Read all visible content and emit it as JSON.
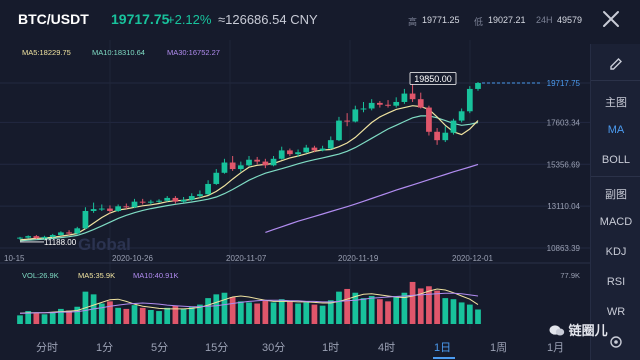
{
  "header": {
    "pair": "BTC/USDT",
    "price": "19717.75",
    "change": "+2.12%",
    "cny": "≈126686.54 CNY",
    "high_label": "高",
    "high_value": "19771.25",
    "low_label": "低",
    "low_value": "19027.21",
    "vol_label": "24H",
    "vol_value": "49579"
  },
  "indicators": {
    "ma5": "MA5:18229.75",
    "ma10": "MA10:18310.64",
    "ma30": "MA30:16752.27"
  },
  "toolbar": {
    "main_label": "主图",
    "ma": "MA",
    "boll": "BOLL",
    "sub_label": "副图",
    "macd": "MACD",
    "kdj": "KDJ",
    "rsi": "RSI",
    "wr": "WR"
  },
  "volume": {
    "vol": "VOL:26.9K",
    "ma5": "MA5:35.9K",
    "ma10": "MA10:40.91K",
    "max": "77.9K"
  },
  "tabs": [
    "分时",
    "1分",
    "5分",
    "15分",
    "30分",
    "1时",
    "4时",
    "1日",
    "1周",
    "1月"
  ],
  "active_tab": "1日",
  "watermark": "链圈儿",
  "watermark_bg": "Global",
  "colors": {
    "up": "#18c29c",
    "down": "#e0566b",
    "ma5": "#f0e3a0",
    "ma10": "#7fdcc4",
    "ma30": "#b18cf0",
    "accent": "#4b9bf0"
  },
  "chart_data": {
    "type": "candlestick",
    "y_ticks": [
      "19717.75",
      "17603.34",
      "15356.69",
      "13110.04",
      "10863.39"
    ],
    "x_ticks": [
      "10-15",
      "2020-10-26",
      "2020-11-07",
      "2020-11-19",
      "2020-12-01"
    ],
    "high_marker": "19850.00",
    "low_marker": "11188.00",
    "last_price": "19717.75",
    "ylim": [
      10863.39,
      19717.75
    ],
    "candles": [
      [
        11380,
        11420,
        11300,
        11460
      ],
      [
        11420,
        11500,
        11380,
        11540
      ],
      [
        11500,
        11390,
        11350,
        11560
      ],
      [
        11390,
        11460,
        11340,
        11520
      ],
      [
        11460,
        11560,
        11420,
        11620
      ],
      [
        11560,
        11700,
        11520,
        11760
      ],
      [
        11700,
        11640,
        11560,
        11820
      ],
      [
        11640,
        11920,
        11600,
        12000
      ],
      [
        11920,
        12850,
        11880,
        13050
      ],
      [
        12850,
        12950,
        12750,
        13300
      ],
      [
        12950,
        12980,
        12850,
        13200
      ],
      [
        12980,
        12850,
        12700,
        13150
      ],
      [
        12850,
        13100,
        12800,
        13200
      ],
      [
        13100,
        13050,
        12950,
        13250
      ],
      [
        13050,
        13350,
        13000,
        13500
      ],
      [
        13350,
        13300,
        13200,
        13500
      ],
      [
        13300,
        13350,
        13200,
        13450
      ],
      [
        13350,
        13400,
        13280,
        13480
      ],
      [
        13400,
        13550,
        13350,
        13650
      ],
      [
        13550,
        13350,
        13250,
        13650
      ],
      [
        13350,
        13450,
        13300,
        13600
      ],
      [
        13450,
        13650,
        13400,
        13800
      ],
      [
        13650,
        13750,
        13550,
        13950
      ],
      [
        13750,
        14300,
        13700,
        14500
      ],
      [
        14300,
        14900,
        14250,
        15100
      ],
      [
        14900,
        15450,
        14850,
        15650
      ],
      [
        15450,
        15100,
        15000,
        15800
      ],
      [
        15100,
        15300,
        14950,
        15500
      ],
      [
        15300,
        15600,
        15250,
        15800
      ],
      [
        15600,
        15500,
        15350,
        15750
      ],
      [
        15500,
        15300,
        15150,
        15650
      ],
      [
        15300,
        15650,
        15250,
        15800
      ],
      [
        15650,
        16100,
        15600,
        16300
      ],
      [
        16100,
        15900,
        15800,
        16200
      ],
      [
        15900,
        16000,
        15750,
        16150
      ],
      [
        16000,
        16250,
        15950,
        16400
      ],
      [
        16250,
        16100,
        16000,
        16350
      ],
      [
        16100,
        16200,
        16050,
        16350
      ],
      [
        16200,
        16650,
        16150,
        16850
      ],
      [
        16650,
        17700,
        16600,
        17900
      ],
      [
        17700,
        17650,
        17400,
        18100
      ],
      [
        17650,
        18300,
        17600,
        18500
      ],
      [
        18300,
        18350,
        18150,
        18700
      ],
      [
        18350,
        18650,
        18250,
        18850
      ],
      [
        18650,
        18550,
        18400,
        18750
      ],
      [
        18550,
        18500,
        18400,
        18800
      ],
      [
        18500,
        18700,
        18400,
        18950
      ],
      [
        18700,
        19150,
        18600,
        19400
      ],
      [
        19150,
        18850,
        18700,
        19850
      ],
      [
        18850,
        18400,
        18350,
        19200
      ],
      [
        18400,
        17100,
        16900,
        18500
      ],
      [
        17100,
        16650,
        16400,
        17300
      ],
      [
        16650,
        17050,
        16550,
        17400
      ],
      [
        17050,
        17700,
        16950,
        17800
      ],
      [
        17700,
        18200,
        17600,
        18350
      ],
      [
        18200,
        19400,
        18100,
        19550
      ],
      [
        19400,
        19717.75,
        19300,
        19771.25
      ]
    ],
    "ma5": [
      11300,
      11340,
      11380,
      11400,
      11440,
      11500,
      11560,
      11640,
      11900,
      12200,
      12500,
      12740,
      12900,
      12960,
      13050,
      13130,
      13180,
      13250,
      13350,
      13400,
      13420,
      13470,
      13560,
      13680,
      13900,
      14200,
      14560,
      14900,
      15200,
      15300,
      15350,
      15400,
      15550,
      15700,
      15800,
      15920,
      16050,
      16120,
      16150,
      16300,
      16500,
      16800,
      17200,
      17600,
      17900,
      18100,
      18300,
      18400,
      18500,
      18450,
      18300,
      17900,
      17450,
      17100,
      16950,
      17250,
      17700
    ],
    "ma10": [
      11250,
      11280,
      11310,
      11340,
      11380,
      11420,
      11470,
      11540,
      11680,
      11850,
      12050,
      12250,
      12450,
      12620,
      12760,
      12880,
      12980,
      13060,
      13140,
      13210,
      13270,
      13330,
      13400,
      13480,
      13600,
      13780,
      14000,
      14250,
      14500,
      14700,
      14880,
      15000,
      15120,
      15250,
      15380,
      15500,
      15600,
      15700,
      15800,
      15900,
      16050,
      16250,
      16500,
      16750,
      17000,
      17250,
      17450,
      17650,
      17850,
      17950,
      17950,
      17850,
      17700,
      17550,
      17450,
      17500,
      17600
    ],
    "ma30": [
      null,
      null,
      null,
      null,
      null,
      null,
      null,
      null,
      null,
      null,
      null,
      null,
      null,
      null,
      null,
      null,
      null,
      null,
      null,
      null,
      null,
      null,
      null,
      null,
      null,
      null,
      null,
      null,
      null,
      null,
      11700,
      11850,
      12000,
      12150,
      12300,
      12430,
      12560,
      12690,
      12820,
      12950,
      13080,
      13220,
      13370,
      13520,
      13670,
      13820,
      13970,
      14110,
      14250,
      14390,
      14530,
      14670,
      14810,
      14950,
      15080,
      15210,
      15350
    ],
    "volumes": [
      16,
      24,
      20,
      18,
      22,
      28,
      25,
      32,
      60,
      55,
      38,
      42,
      30,
      28,
      35,
      30,
      26,
      24,
      30,
      34,
      28,
      32,
      36,
      48,
      55,
      58,
      50,
      42,
      40,
      38,
      44,
      40,
      46,
      42,
      38,
      40,
      36,
      34,
      44,
      60,
      65,
      58,
      48,
      52,
      46,
      42,
      50,
      58,
      78,
      66,
      70,
      62,
      48,
      46,
      40,
      36,
      26.9
    ],
    "vol_ma5": [
      20,
      21,
      21,
      21,
      22,
      23,
      24,
      25,
      30,
      35,
      40,
      45,
      46,
      42,
      37,
      33,
      31,
      29,
      28,
      28,
      28,
      29,
      31,
      35,
      40,
      45,
      50,
      52,
      50,
      47,
      44,
      42,
      42,
      42,
      41,
      41,
      40,
      39,
      39,
      42,
      46,
      51,
      55,
      56,
      54,
      52,
      50,
      49,
      52,
      56,
      61,
      65,
      63,
      58,
      52,
      46,
      36
    ],
    "vol_ma10": [
      20,
      20,
      21,
      21,
      21,
      22,
      22,
      23,
      25,
      28,
      30,
      33,
      35,
      37,
      38,
      39,
      38,
      37,
      35,
      34,
      33,
      32,
      32,
      33,
      34,
      36,
      38,
      40,
      42,
      43,
      44,
      44,
      44,
      43,
      43,
      42,
      42,
      41,
      41,
      42,
      43,
      44,
      46,
      48,
      49,
      50,
      51,
      52,
      53,
      54,
      55,
      56,
      57,
      57,
      56,
      54,
      52
    ]
  }
}
